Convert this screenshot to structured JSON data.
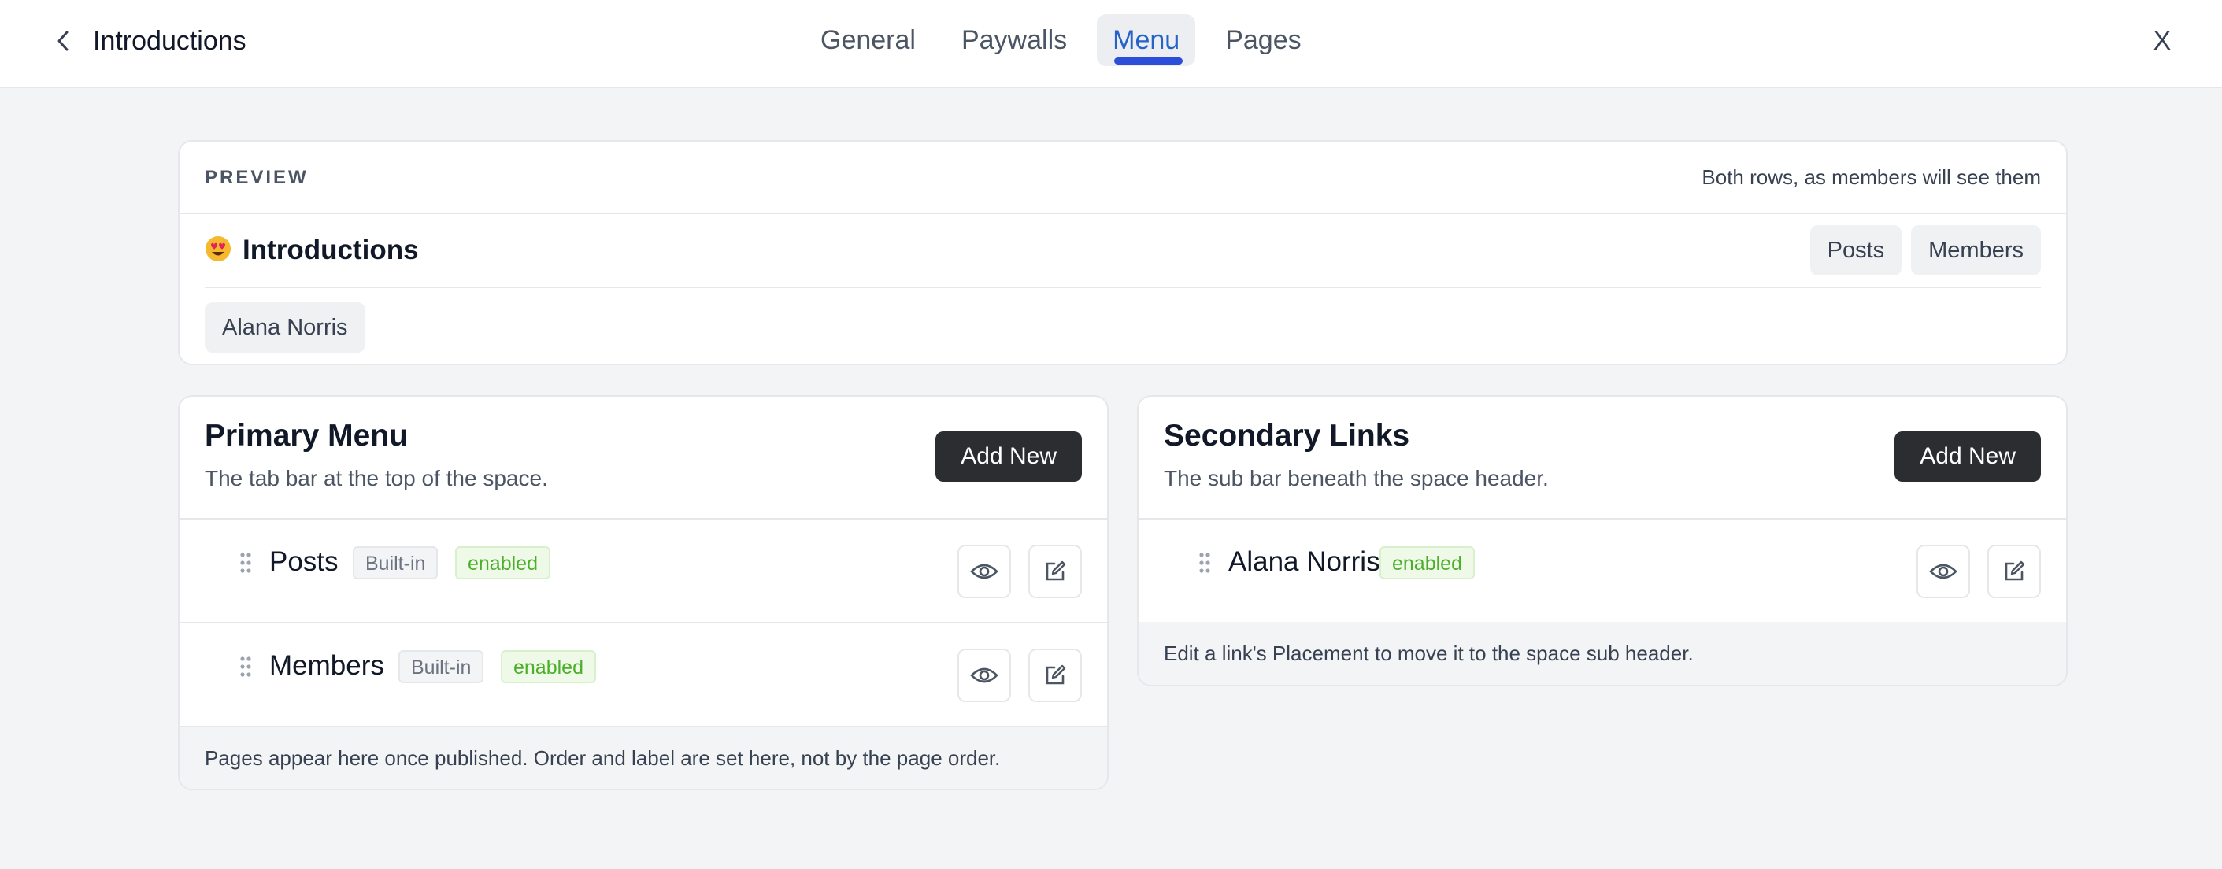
{
  "topbar": {
    "title": "Introductions",
    "tabs": [
      "General",
      "Paywalls",
      "Menu",
      "Pages"
    ],
    "active_tab": "Menu",
    "close_label": "X"
  },
  "preview": {
    "label": "PREVIEW",
    "note": "Both rows, as members will see them",
    "space_emoji": "heart-eyes-emoji",
    "space_name": "Introductions",
    "tabs": [
      "Posts",
      "Members"
    ],
    "sub_links": [
      "Alana Norris"
    ]
  },
  "primary": {
    "title": "Primary Menu",
    "description": "The tab bar at the top of the space.",
    "add_label": "Add New",
    "items": [
      {
        "label": "Posts",
        "builtin": "Built-in",
        "status": "enabled"
      },
      {
        "label": "Members",
        "builtin": "Built-in",
        "status": "enabled"
      }
    ],
    "footer": "Pages appear here once published. Order and label are set here, not by the page order."
  },
  "secondary": {
    "title": "Secondary Links",
    "description": "The sub bar beneath the space header.",
    "add_label": "Add New",
    "items": [
      {
        "label": "Alana Norris",
        "status": "enabled"
      }
    ],
    "footer": "Edit a link's Placement to move it to the space sub header."
  },
  "colors": {
    "accent": "#2b4fd8",
    "active_tab_text": "#2563c9",
    "primary_button": "#2b2d31",
    "enabled_badge_text": "#4caf2a",
    "enabled_badge_bg": "#eef9e8"
  }
}
